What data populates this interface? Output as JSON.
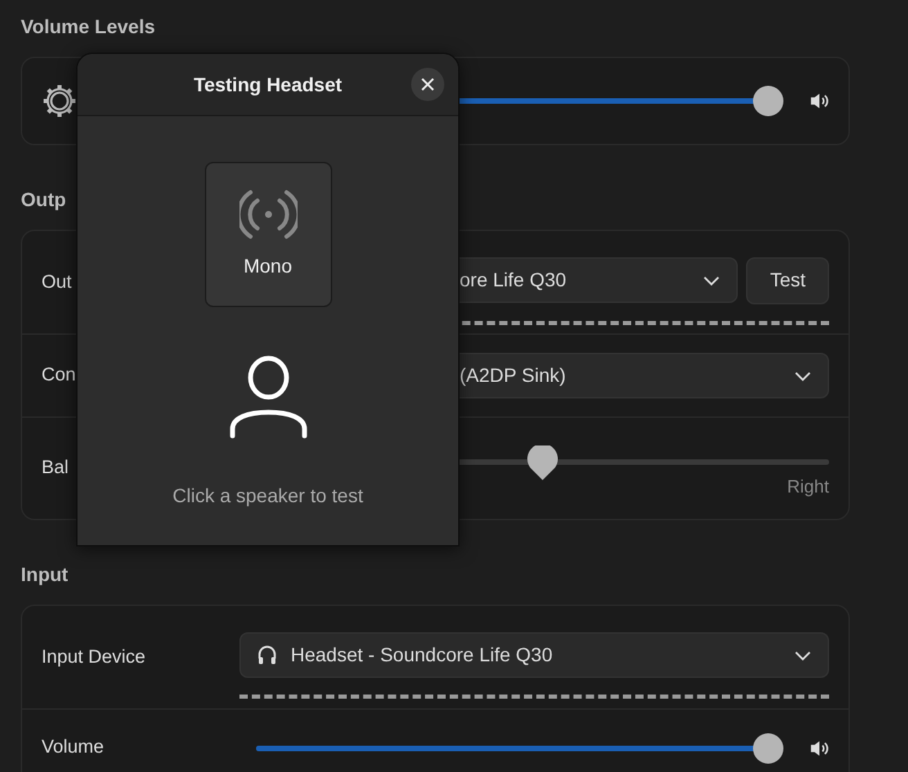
{
  "volume_levels": {
    "title": "Volume Levels",
    "rows": [
      {
        "kind": "app-volume",
        "level": 1
      }
    ]
  },
  "output": {
    "title": "Outp",
    "rows": [
      {
        "kind": "output-device",
        "label": "Out",
        "value": "ore Life Q30",
        "button": "Test"
      },
      {
        "kind": "combo",
        "label": "Con",
        "value": "(A2DP Sink)"
      },
      {
        "kind": "balance",
        "label": "Bal",
        "level": 0.5,
        "end_label": "Right"
      }
    ]
  },
  "input": {
    "title": "Input",
    "rows": [
      {
        "kind": "input-device",
        "label": "Input Device",
        "value": "Headset - Soundcore Life Q30"
      },
      {
        "kind": "volume",
        "label": "Volume",
        "level": 1
      }
    ]
  },
  "dialog": {
    "title": "Testing Headset",
    "speakers": [
      {
        "label": "Mono"
      }
    ],
    "hint": "Click a speaker to test"
  }
}
